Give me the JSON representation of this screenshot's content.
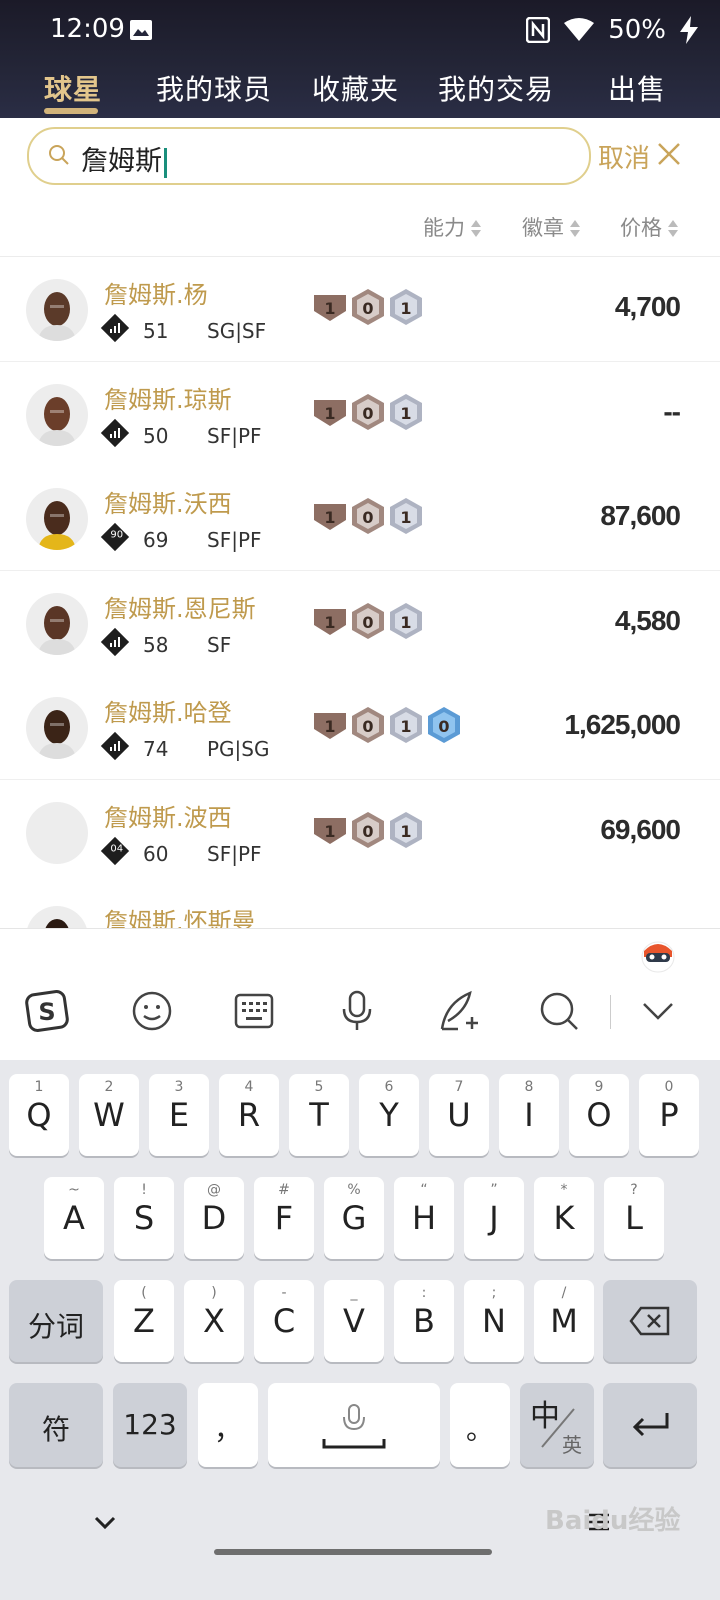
{
  "status_bar": {
    "time": "12:09",
    "battery": "50%"
  },
  "tabs": [
    {
      "label": "球星",
      "active": true
    },
    {
      "label": "我的球员",
      "active": false
    },
    {
      "label": "收藏夹",
      "active": false
    },
    {
      "label": "我的交易",
      "active": false
    },
    {
      "label": "出售",
      "active": false
    }
  ],
  "search": {
    "value": "詹姆斯",
    "cancel_label": "取消"
  },
  "sort": {
    "ability": "能力",
    "badges": "徽章",
    "price": "价格"
  },
  "players": [
    {
      "name": "詹姆斯.杨",
      "ovr": "51",
      "positions": "SG|SF",
      "badges": [
        "1",
        "0",
        "1"
      ],
      "price": "4,700",
      "rating_tag": ""
    },
    {
      "name": "詹姆斯.琼斯",
      "ovr": "50",
      "positions": "SF|PF",
      "badges": [
        "1",
        "0",
        "1"
      ],
      "price": "--",
      "rating_tag": ""
    },
    {
      "name": "詹姆斯.沃西",
      "ovr": "69",
      "positions": "SF|PF",
      "badges": [
        "1",
        "0",
        "1"
      ],
      "price": "87,600",
      "rating_tag": "90"
    },
    {
      "name": "詹姆斯.恩尼斯",
      "ovr": "58",
      "positions": "SF",
      "badges": [
        "1",
        "0",
        "1"
      ],
      "price": "4,580",
      "rating_tag": ""
    },
    {
      "name": "詹姆斯.哈登",
      "ovr": "74",
      "positions": "PG|SG",
      "badges": [
        "1",
        "0",
        "1",
        "0"
      ],
      "price": "1,625,000",
      "rating_tag": ""
    },
    {
      "name": "詹姆斯.波西",
      "ovr": "60",
      "positions": "SF|PF",
      "badges": [
        "1",
        "0",
        "1"
      ],
      "price": "69,600",
      "rating_tag": "04"
    },
    {
      "name": "詹姆斯.怀斯曼",
      "ovr": "",
      "positions": "",
      "badges": [],
      "price": "",
      "rating_tag": ""
    }
  ],
  "keyboard": {
    "row1": [
      [
        "Q",
        "1"
      ],
      [
        "W",
        "2"
      ],
      [
        "E",
        "3"
      ],
      [
        "R",
        "4"
      ],
      [
        "T",
        "5"
      ],
      [
        "Y",
        "6"
      ],
      [
        "U",
        "7"
      ],
      [
        "I",
        "8"
      ],
      [
        "O",
        "9"
      ],
      [
        "P",
        "0"
      ]
    ],
    "row2": [
      [
        "A",
        "~"
      ],
      [
        "S",
        "!"
      ],
      [
        "D",
        "@"
      ],
      [
        "F",
        "#"
      ],
      [
        "G",
        "%"
      ],
      [
        "H",
        "“"
      ],
      [
        "J",
        "”"
      ],
      [
        "K",
        "*"
      ],
      [
        "L",
        "?"
      ]
    ],
    "row3": [
      [
        "Z",
        "("
      ],
      [
        "X",
        ")"
      ],
      [
        "C",
        "-"
      ],
      [
        "V",
        "_"
      ],
      [
        "B",
        ":"
      ],
      [
        "N",
        ";"
      ],
      [
        "M",
        "/"
      ]
    ],
    "fenci": "分词",
    "fu": "符",
    "num": "123",
    "comma": "，",
    "period": "。",
    "zh": "中",
    "en": "英"
  },
  "watermark": "Baidu经验",
  "colors": {
    "gold": "#bf9a4d",
    "accent_tab": "#e3c68c",
    "bronze_badge": "#8d6e63",
    "silver_badge": "#aeb3c2",
    "blue_badge": "#5b9bd5"
  }
}
